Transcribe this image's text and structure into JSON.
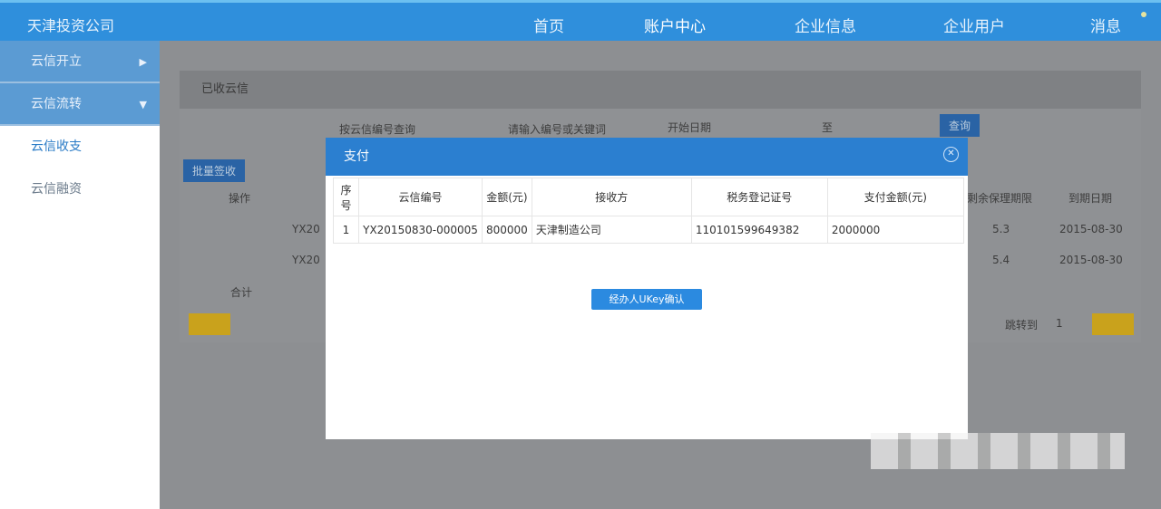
{
  "header": {
    "logo": "天津投资公司",
    "nav": [
      "首页",
      "账户中心",
      "企业信息",
      "企业用户",
      "消息"
    ]
  },
  "sidebar": {
    "items": [
      {
        "label": "云信开立",
        "arrow": "▶"
      },
      {
        "label": "云信流转",
        "arrow": "▼"
      },
      {
        "label": "云信收支"
      },
      {
        "label": "云信融资"
      }
    ]
  },
  "background": {
    "title": "已收云信",
    "search_type": "按云信编号查询",
    "search_placeholder": "请输入编号或关键词",
    "start_date": "开始日期",
    "to": "至",
    "query": "查询",
    "batch": "批量签收",
    "col_op": "操作",
    "col_term": "剩余保理期限",
    "col_due": "到期日期",
    "rows": [
      {
        "no": "YX20",
        "term": "5.3",
        "due": "2015-08-30"
      },
      {
        "no": "YX20",
        "term": "5.4",
        "due": "2015-08-30"
      }
    ],
    "total": "合计",
    "jump": "跳转到",
    "page": "1"
  },
  "modal": {
    "title": "支付",
    "columns": [
      "序号",
      "云信编号",
      "金额(元)",
      "接收方",
      "税务登记证号",
      "支付金额(元)"
    ],
    "rows": [
      [
        "1",
        "YX20150830-000005",
        "800000",
        "天津制造公司",
        "110101599649382",
        "2000000"
      ]
    ],
    "confirm": "经办人UKey确认"
  }
}
